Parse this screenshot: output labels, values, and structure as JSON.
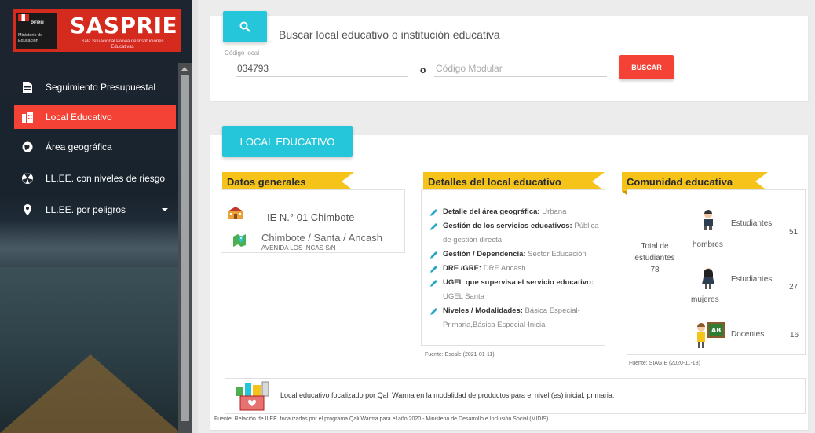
{
  "sidebar": {
    "logo": {
      "country": "PERÚ",
      "ministry": "Ministerio de Educación",
      "title": "SASPRIE",
      "subtitle": "Sala Situacional Previa de Instituciones Educativas"
    },
    "items": [
      {
        "label": "Seguimiento Presupuestal",
        "icon": "file-icon",
        "active": false
      },
      {
        "label": "Local Educativo",
        "icon": "building-icon",
        "active": true
      },
      {
        "label": "Área geográfica",
        "icon": "globe-icon",
        "active": false
      },
      {
        "label": "LL.EE. con niveles de riesgo",
        "icon": "radiation-icon",
        "active": false
      },
      {
        "label": "LL.EE. por peligros",
        "icon": "location-pin-icon",
        "active": false
      }
    ]
  },
  "search": {
    "title": "Buscar local educativo o institución educativa",
    "codigo_local_label": "Código local",
    "codigo_local_value": "034793",
    "separator": "o",
    "codigo_modular_placeholder": "Código Modular",
    "button_label": "BUSCAR"
  },
  "local": {
    "tab_label": "LOCAL EDUCATIVO",
    "datos": {
      "heading": "Datos generales",
      "ie_name": "IE N.° 01 Chimbote",
      "location": "Chimbote / Santa / Ancash",
      "address": "AVENIDA LOS INCAS S/N"
    },
    "detalles": {
      "heading": "Detalles del local educativo",
      "items": [
        {
          "label": "Detalle del área geográfica:",
          "value": "Urbana"
        },
        {
          "label": "Gestión de los servicios educativos:",
          "value": "Pública de gestión directa"
        },
        {
          "label": "Gestión / Dependencia:",
          "value": "Sector Educación"
        },
        {
          "label": "DRE /GRE:",
          "value": "DRE Ancash"
        },
        {
          "label": "UGEL que supervisa el servicio educativo:",
          "value": "UGEL Santa"
        },
        {
          "label": "Niveles / Modalidades:",
          "value": "Básica Especial-Primaria,Básica Especial-Inicial"
        }
      ],
      "source": "Fuente: Escale (2021-01-11)"
    },
    "comunidad": {
      "heading": "Comunidad educativa",
      "total_label": "Total de estudiantes",
      "total_value": "78",
      "hombres_label": "Estudiantes",
      "hombres_sub": "hombres",
      "hombres_value": "51",
      "mujeres_label": "Estudiantes",
      "mujeres_sub": "mujeres",
      "mujeres_value": "27",
      "docentes_label": "Docentes",
      "docentes_value": "16",
      "source": "Fuente: SIAGIE (2020-11-18)"
    },
    "qali_text": "Local educativo focalizado por Qali Warma en la modalidad de productos para el nivel (es) inicial, primaria.",
    "footnote": "Fuente: Relación de II.EE. focalizadas por el programa Qali Warma para el año 2020 - Ministerio de Desarrollo e Inclusión Social (MIDIS)"
  },
  "colors": {
    "accent_red": "#f44336",
    "accent_cyan": "#26c6da",
    "ribbon_yellow": "#f6c31b"
  }
}
